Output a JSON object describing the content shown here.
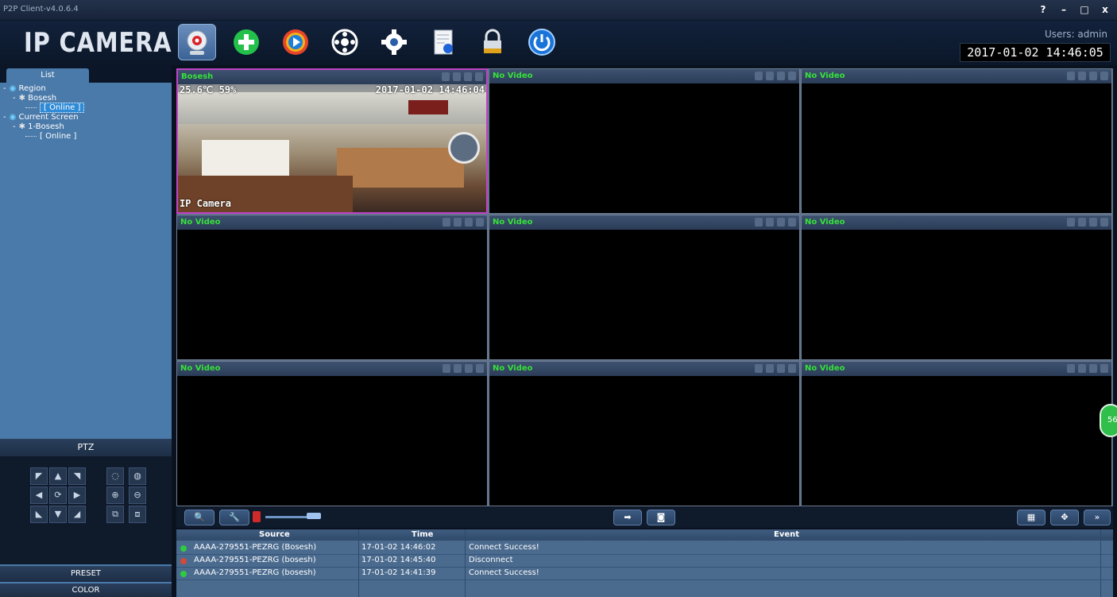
{
  "app": {
    "title": "P2P Client-v4.0.6.4",
    "logo": "IP CAMERA",
    "window_buttons": [
      "?",
      "–",
      "□",
      "x"
    ]
  },
  "toolbar": {
    "items": [
      {
        "name": "camera-view",
        "icon": "webcam-icon"
      },
      {
        "name": "add-device",
        "icon": "plus-icon"
      },
      {
        "name": "playback",
        "icon": "play-icon"
      },
      {
        "name": "ptz-control",
        "icon": "wheel-icon"
      },
      {
        "name": "settings",
        "icon": "gear-icon"
      },
      {
        "name": "log",
        "icon": "document-icon"
      },
      {
        "name": "lock",
        "icon": "lock-icon"
      },
      {
        "name": "power",
        "icon": "power-icon"
      }
    ]
  },
  "user": {
    "label": "Users: admin",
    "datetime": "2017-01-02 14:46:05"
  },
  "left": {
    "tab": "List",
    "tree": [
      {
        "prefix": "-",
        "label": "Region",
        "level": 0
      },
      {
        "prefix": "-",
        "label": "Bosesh",
        "level": 1
      },
      {
        "prefix": "",
        "label": "[ Online ]",
        "level": 2,
        "selected": true
      },
      {
        "prefix": "-",
        "label": "Current Screen",
        "level": 0
      },
      {
        "prefix": "-",
        "label": "1-Bosesh",
        "level": 1
      },
      {
        "prefix": "",
        "label": "[ Online ]",
        "level": 2,
        "selected": false
      }
    ],
    "ptz_label": "PTZ",
    "preset_label": "PRESET",
    "color_label": "COLOR"
  },
  "video": {
    "cells": [
      {
        "label": "Bosesh",
        "active": true,
        "osd_top": "25.6℃ 59%",
        "osd_time": "2017-01-02 14:46:04",
        "osd_bottom": "IP Camera"
      },
      {
        "label": "No Video",
        "active": false
      },
      {
        "label": "No Video",
        "active": false
      },
      {
        "label": "No Video",
        "active": false
      },
      {
        "label": "No Video",
        "active": false
      },
      {
        "label": "No Video",
        "active": false
      },
      {
        "label": "No Video",
        "active": false
      },
      {
        "label": "No Video",
        "active": false
      },
      {
        "label": "No Video",
        "active": false
      }
    ]
  },
  "log": {
    "headers": {
      "source": "Source",
      "time": "Time",
      "event": "Event"
    },
    "rows": [
      {
        "source": "AAAA-279551-PEZRG (Bosesh)",
        "time": "17-01-02 14:46:02",
        "event": "Connect Success!",
        "status": "ok"
      },
      {
        "source": "AAAA-279551-PEZRG (bosesh)",
        "time": "17-01-02 14:45:40",
        "event": "Disconnect",
        "status": "warn"
      },
      {
        "source": "AAAA-279551-PEZRG (bosesh)",
        "time": "17-01-02 14:41:39",
        "event": "Connect Success!",
        "status": "ok"
      }
    ]
  },
  "badge": {
    "value": "56"
  },
  "colors": {
    "accent": "#4a7aaa",
    "ok": "#2ecc40",
    "no_video": "#37e03a",
    "selected_border": "#c044c8"
  }
}
